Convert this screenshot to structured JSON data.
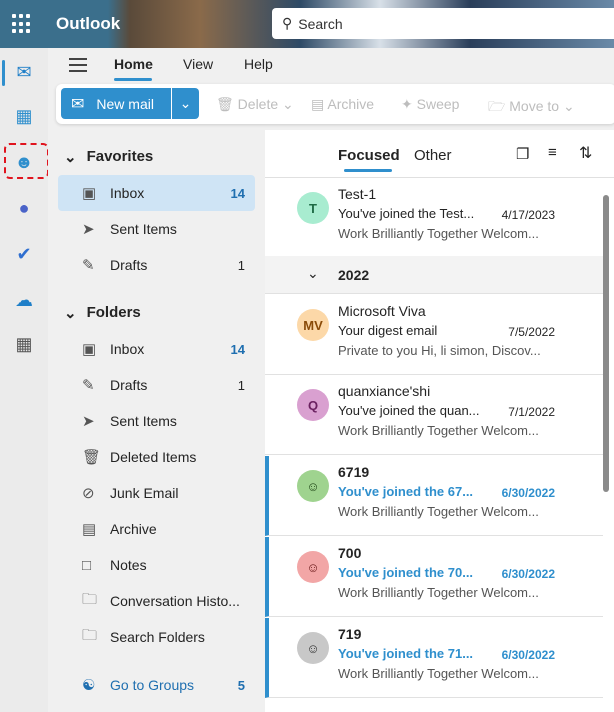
{
  "app": {
    "title": "Outlook",
    "search_placeholder": "Search"
  },
  "nav": {
    "tabs": [
      "Home",
      "View",
      "Help"
    ],
    "active": "Home"
  },
  "ribbon": {
    "new_mail": "New mail",
    "delete": "Delete",
    "archive": "Archive",
    "sweep": "Sweep",
    "move_to": "Move to"
  },
  "favorites": {
    "title": "Favorites",
    "items": [
      {
        "label": "Inbox",
        "count": "14"
      },
      {
        "label": "Sent Items",
        "count": ""
      },
      {
        "label": "Drafts",
        "count": "1"
      }
    ]
  },
  "folders": {
    "title": "Folders",
    "items": [
      {
        "label": "Inbox",
        "count": "14"
      },
      {
        "label": "Drafts",
        "count": "1"
      },
      {
        "label": "Sent Items",
        "count": ""
      },
      {
        "label": "Deleted Items",
        "count": ""
      },
      {
        "label": "Junk Email",
        "count": ""
      },
      {
        "label": "Archive",
        "count": ""
      },
      {
        "label": "Notes",
        "count": ""
      },
      {
        "label": "Conversation Histo...",
        "count": ""
      },
      {
        "label": "Search Folders",
        "count": ""
      }
    ]
  },
  "groups": {
    "label": "Go to Groups",
    "count": "5"
  },
  "list": {
    "tabs": [
      "Focused",
      "Other"
    ],
    "group_label": "2022",
    "messages": [
      {
        "initials": "T",
        "from": "Test-1",
        "subject": "You've joined the Test...",
        "date": "4/17/2023",
        "preview": "Work Brilliantly Together Welcom...",
        "color": "#a8ecd0",
        "fg": "#1e6b45"
      },
      {
        "initials": "MV",
        "from": "Microsoft Viva",
        "subject": "Your digest email",
        "date": "7/5/2022",
        "preview": "Private to you Hi, li simon, Discov...",
        "color": "#fcd8a8",
        "fg": "#8a4b08"
      },
      {
        "initials": "Q",
        "from": "quanxiance'shi",
        "subject": "You've joined the quan...",
        "date": "7/1/2022",
        "preview": "Work Brilliantly Together Welcom...",
        "color": "#d9a0d0",
        "fg": "#6a2060"
      },
      {
        "initials": "",
        "from": "6719",
        "subject": "You've joined the 67...",
        "date": "6/30/2022",
        "preview": "Work Brilliantly Together Welcom...",
        "color": "#9fd38f",
        "fg": "#234a1a"
      },
      {
        "initials": "",
        "from": "700",
        "subject": "You've joined the 70...",
        "date": "6/30/2022",
        "preview": "Work Brilliantly Together Welcom...",
        "color": "#f2a6a6",
        "fg": "#6a1a1a"
      },
      {
        "initials": "",
        "from": "719",
        "subject": "You've joined the 71...",
        "date": "6/30/2022",
        "preview": "Work Brilliantly Together Welcom...",
        "color": "#c8c8c8",
        "fg": "#333"
      }
    ]
  }
}
